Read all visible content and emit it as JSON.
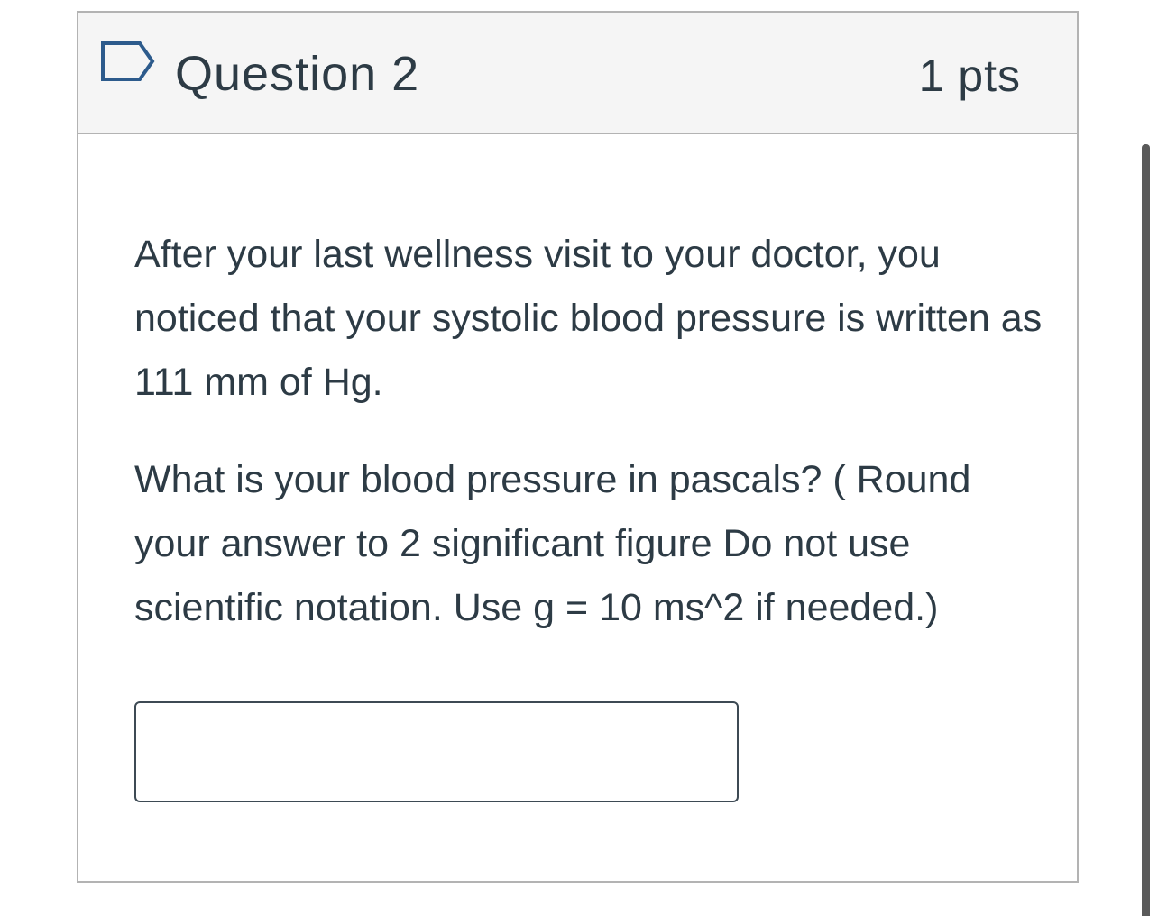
{
  "question": {
    "title": "Question 2",
    "points": "1 pts",
    "flag_icon": "flag-outline-icon",
    "paragraphs": [
      "After your last wellness visit to your doctor, you noticed that your systolic blood pressure is written as  111 mm of Hg.",
      "What is your blood pressure in pascals? ( Round your answer to 2 significant figure Do not use scientific notation. Use g = 10 ms^2 if needed.)"
    ],
    "answer": {
      "value": "",
      "placeholder": ""
    }
  },
  "colors": {
    "text": "#2d3b45",
    "header_bg": "#f5f5f5",
    "border": "#b3b3b3",
    "flag": "#2d5b8c"
  }
}
